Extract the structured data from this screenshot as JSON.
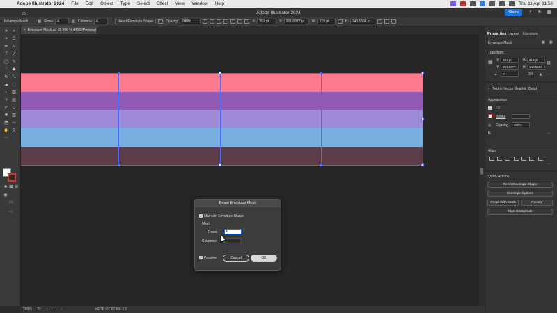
{
  "menubar": {
    "app_name": "Adobe Illustrator 2024",
    "items": [
      "File",
      "Edit",
      "Object",
      "Type",
      "Select",
      "Effect",
      "View",
      "Window",
      "Help"
    ],
    "datetime": "Thu 11 Apr  11:56"
  },
  "titlebar": {
    "title": "Adobe Illustrator 2024",
    "share_label": "Share"
  },
  "controlbar": {
    "mode_label": "Envelope Mesh",
    "rows_label": "Rows:",
    "rows_value": "4",
    "columns_label": "Columns:",
    "columns_value": "4",
    "reset_button": "Reset Envelope Shape",
    "opacity_label": "Opacity:",
    "opacity_value": "100%",
    "x_label": "X:",
    "x_value": "391 pt",
    "y_label": "Y:",
    "y_value": "261.6377 pt",
    "w_label": "W:",
    "w_value": "619 pt",
    "h_label": "H:",
    "h_value": "140.5506 pt"
  },
  "document_tab": {
    "title": "Envelope Mesh.ai* @ 200 % (RGB/Preview)"
  },
  "canvas": {
    "band_colors": [
      "#fd7a8c",
      "#9159b3",
      "#9e8ad8",
      "#79aee0",
      "#5b3c48"
    ]
  },
  "statusbar": {
    "zoom": "200%",
    "rotation": "0°",
    "artboard": "1",
    "color_profile": "sRGB IEC61966-2.1"
  },
  "panel": {
    "tabs": [
      "Properties",
      "Layers",
      "Libraries"
    ],
    "selection_label": "Envelope Mesh",
    "transform_heading": "Transform",
    "x_label": "X:",
    "x_value": "391 pt",
    "y_label": "Y:",
    "y_value": "261.6377",
    "w_label": "W:",
    "w_value": "619 pt",
    "h_label": "H:",
    "h_value": "140.5506",
    "angle_value": "0°",
    "ratio_value": "3/4",
    "text_to_vector": "Text to Vector Graphic (Beta)",
    "appearance_heading": "Appearance",
    "fill_label": "Fill",
    "stroke_label": "Stroke",
    "opacity_label": "Opacity",
    "opacity_value": "100%",
    "fx_label": "fx",
    "align_heading": "Align",
    "quick_actions_heading": "Quick Actions",
    "qa_reset_envelope": "Reset Envelope Shape",
    "qa_envelope_options": "Envelope Options",
    "qa_reset_with_mesh": "Reset With Mesh",
    "qa_recolor": "Recolor",
    "qa_start_global_edit": "Start Global Edit"
  },
  "dialog": {
    "title": "Reset Envelope Mesh",
    "maintain_label": "Maintain Envelope Shape",
    "maintain_checked": true,
    "mesh_heading": "Mesh",
    "rows_label": "Rows:",
    "rows_value": "4",
    "columns_label": "Columns:",
    "columns_value": "",
    "preview_label": "Preview",
    "preview_checked": true,
    "cancel_label": "Cancel",
    "ok_label": "OK"
  }
}
